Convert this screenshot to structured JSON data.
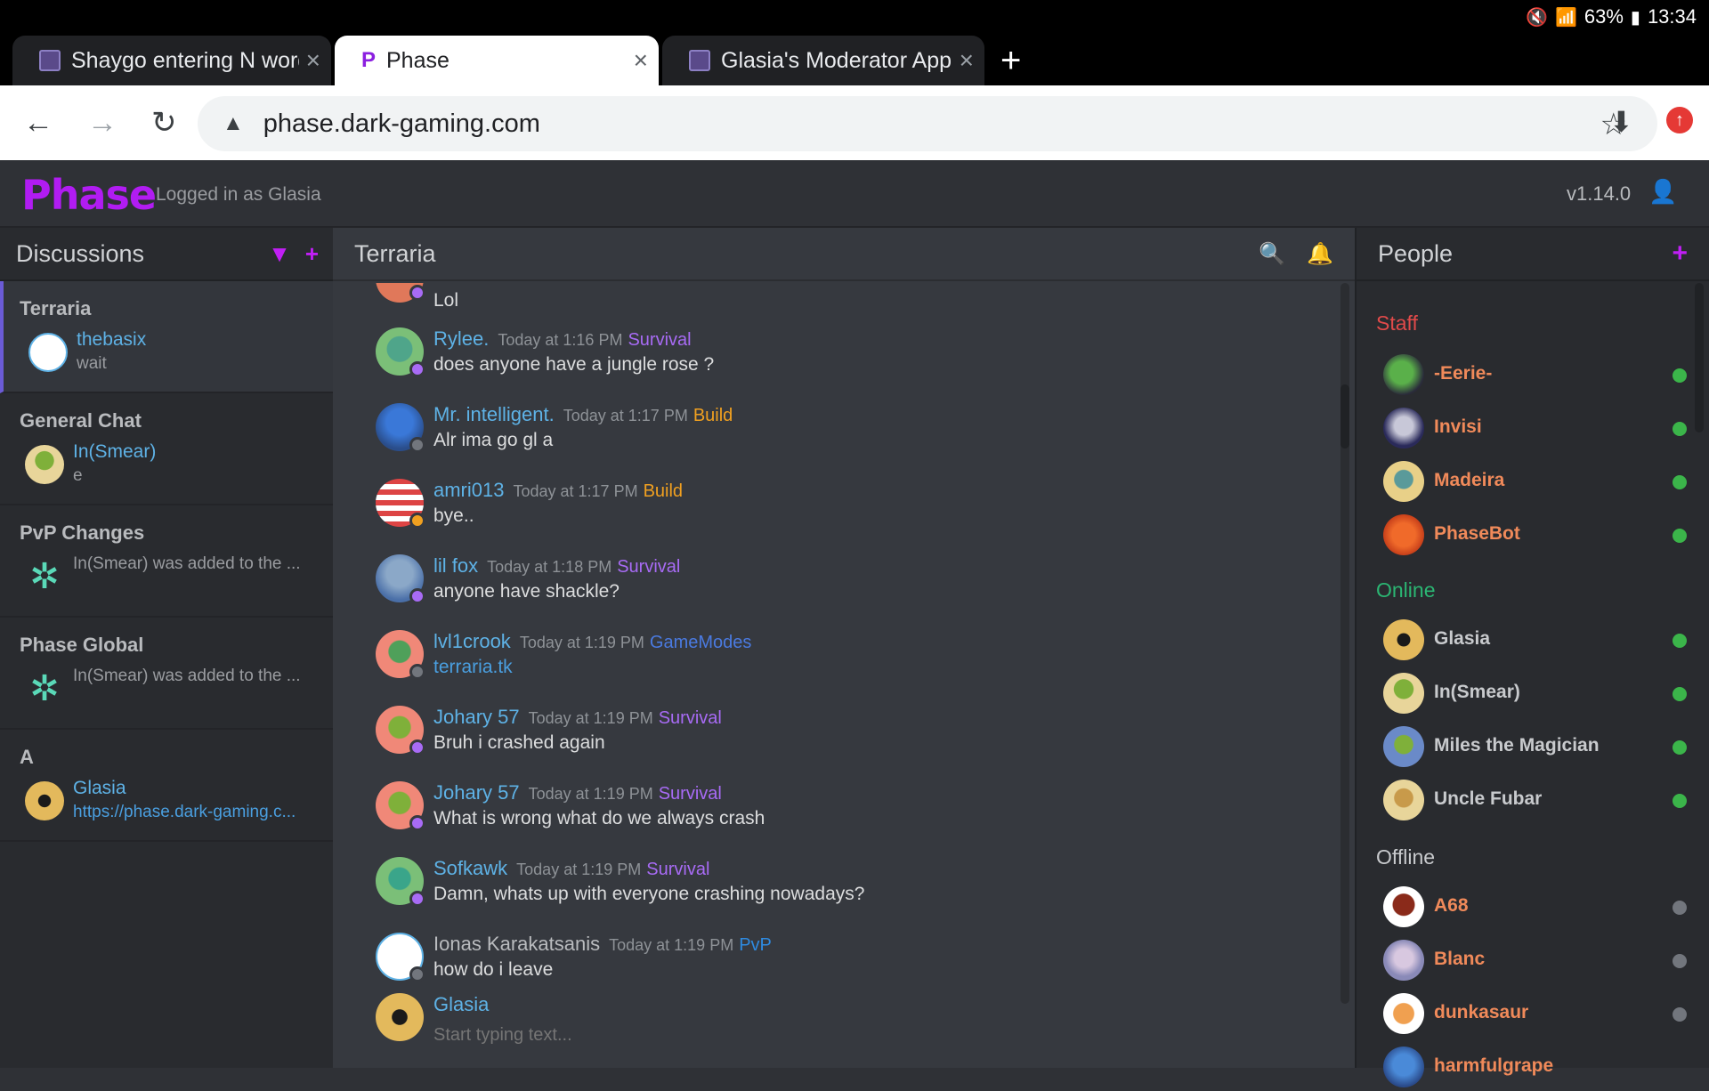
{
  "status_bar": {
    "battery": "63%",
    "time": "13:34"
  },
  "tabs": [
    {
      "title": "Shaygo entering N word -",
      "active": false,
      "favicon": "dark-gaming-icon"
    },
    {
      "title": "Phase",
      "active": true,
      "favicon": "phase-icon"
    },
    {
      "title": "Glasia's Moderator Applic",
      "active": false,
      "favicon": "dark-gaming-icon"
    }
  ],
  "browser": {
    "url": "phase.dark-gaming.com"
  },
  "app": {
    "logo": "Phase",
    "logged_in": "Logged in as Glasia",
    "version": "v1.14.0"
  },
  "discussions": {
    "title": "Discussions",
    "items": [
      {
        "name": "Terraria",
        "who": "thebasix",
        "message": "wait",
        "active": true
      },
      {
        "name": "General Chat",
        "who": "In(Smear)",
        "message": "e"
      },
      {
        "name": "PvP Changes",
        "who": "",
        "message": "In(Smear) was added to the ..."
      },
      {
        "name": "Phase Global",
        "who": "",
        "message": "In(Smear) was added to the ..."
      },
      {
        "name": "A",
        "who": "Glasia",
        "message": "https://phase.dark-gaming.c..."
      }
    ]
  },
  "channel": {
    "title": "Terraria",
    "partial_message": "Lol",
    "messages": [
      {
        "author": "Rylee.",
        "time": "Today at 1:16 PM",
        "tag": "Survival",
        "text": "does anyone have a jungle rose ?"
      },
      {
        "author": "Mr. intelligent.",
        "time": "Today at 1:17 PM",
        "tag": "Build",
        "text": "Alr ima go gl a"
      },
      {
        "author": "amri013",
        "time": "Today at 1:17 PM",
        "tag": "Build",
        "text": "bye.."
      },
      {
        "author": "lil fox",
        "time": "Today at 1:18 PM",
        "tag": "Survival",
        "text": "anyone have shackle?"
      },
      {
        "author": "lvl1crook",
        "time": "Today at 1:19 PM",
        "tag": "GameModes",
        "text": "terraria.tk"
      },
      {
        "author": "Johary 57",
        "time": "Today at 1:19 PM",
        "tag": "Survival",
        "text": "Bruh i crashed again"
      },
      {
        "author": "Johary 57",
        "time": "Today at 1:19 PM",
        "tag": "Survival",
        "text": "What is wrong what do we always crash"
      },
      {
        "author": "Sofkawk",
        "time": "Today at 1:19 PM",
        "tag": "Survival",
        "text": "Damn, whats up with everyone crashing nowadays?"
      },
      {
        "author": "Ionas Karakatsanis",
        "time": "Today at 1:19 PM",
        "tag": "PvP",
        "text": "how do i leave"
      }
    ],
    "composer": {
      "user": "Glasia",
      "placeholder": "Start typing text..."
    }
  },
  "people": {
    "title": "People",
    "staff_title": "Staff",
    "staff": [
      "-Eerie-",
      "Invisi",
      "Madeira",
      "PhaseBot"
    ],
    "online_title": "Online",
    "online": [
      "Glasia",
      "In(Smear)",
      "Miles the Magician",
      "Uncle Fubar"
    ],
    "offline_title": "Offline",
    "offline": [
      "A68",
      "Blanc",
      "dunkasaur",
      "harmfulgrape"
    ]
  },
  "colors": {
    "accent": "#c01ff5",
    "staff": "#e04a4a",
    "online": "#2bb673",
    "survival": "#a86bf5",
    "build": "#f0a020",
    "gamemodes": "#4a7ae0",
    "pvp": "#2e8ae0"
  }
}
